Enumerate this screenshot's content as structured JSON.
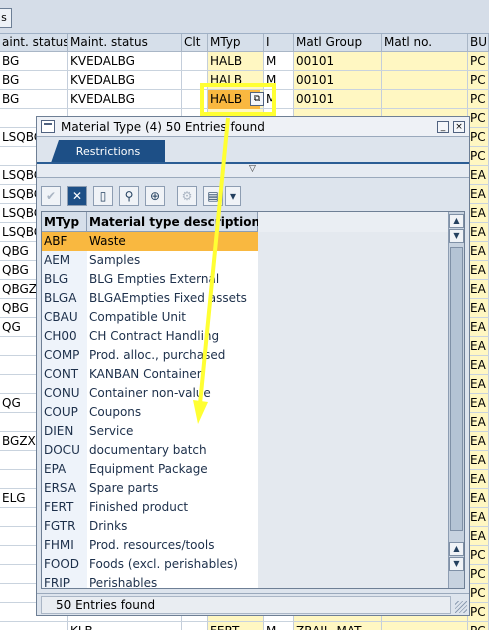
{
  "background": {
    "toolbar_button": "s",
    "headers": [
      "aint. status",
      "Maint. status",
      "Clt",
      "MTyp",
      "I",
      "Matl Group",
      "Matl no.",
      "BU"
    ],
    "rows": [
      {
        "c0": "BG",
        "c1": "KVEDALBG",
        "mtyp": "HALB",
        "i": "M",
        "grp": "00101",
        "bu": "PC"
      },
      {
        "c0": "BG",
        "c1": "KVEDALBG",
        "mtyp": "HALB",
        "i": "M",
        "grp": "00101",
        "bu": "PC"
      },
      {
        "c0": "BG",
        "c1": "KVEDALBG",
        "mtyp": "HALB",
        "i": "M",
        "grp": "00101",
        "bu": "PC"
      },
      {
        "c0": "",
        "c1": "",
        "mtyp": "",
        "i": "",
        "grp": "",
        "bu": "PC"
      },
      {
        "c0": "LSQBG",
        "c1": "",
        "mtyp": "",
        "i": "",
        "grp": "",
        "bu": "PC"
      },
      {
        "c0": "",
        "c1": "",
        "mtyp": "",
        "i": "",
        "grp": "",
        "bu": "PC"
      },
      {
        "c0": "LSQBG",
        "c1": "",
        "mtyp": "",
        "i": "",
        "grp": "",
        "bu": "EA"
      },
      {
        "c0": "LSQBG",
        "c1": "",
        "mtyp": "",
        "i": "",
        "grp": "",
        "bu": "EA"
      },
      {
        "c0": "LSQBG",
        "c1": "",
        "mtyp": "",
        "i": "",
        "grp": "",
        "bu": "EA"
      },
      {
        "c0": "LSQBG",
        "c1": "",
        "mtyp": "",
        "i": "",
        "grp": "",
        "bu": "EA"
      },
      {
        "c0": "QBG",
        "c1": "",
        "mtyp": "",
        "i": "",
        "grp": "",
        "bu": "EA"
      },
      {
        "c0": "QBG",
        "c1": "",
        "mtyp": "",
        "i": "",
        "grp": "",
        "bu": "EA"
      },
      {
        "c0": "QBGZX",
        "c1": "",
        "mtyp": "",
        "i": "",
        "grp": "",
        "bu": "EA"
      },
      {
        "c0": "QBG",
        "c1": "",
        "mtyp": "",
        "i": "",
        "grp": "",
        "bu": "EA"
      },
      {
        "c0": "QG",
        "c1": "",
        "mtyp": "",
        "i": "",
        "grp": "",
        "bu": "EA"
      },
      {
        "c0": "",
        "c1": "",
        "mtyp": "",
        "i": "",
        "grp": "",
        "bu": "EA"
      },
      {
        "c0": "",
        "c1": "",
        "mtyp": "",
        "i": "",
        "grp": "",
        "bu": "EA"
      },
      {
        "c0": "",
        "c1": "",
        "mtyp": "",
        "i": "",
        "grp": "",
        "bu": "EA"
      },
      {
        "c0": "QG",
        "c1": "",
        "mtyp": "",
        "i": "",
        "grp": "",
        "bu": "EA"
      },
      {
        "c0": "",
        "c1": "",
        "mtyp": "",
        "i": "",
        "grp": "",
        "bu": "EA"
      },
      {
        "c0": "BGZX",
        "c1": "",
        "mtyp": "",
        "i": "",
        "grp": "",
        "bu": "EA"
      },
      {
        "c0": "",
        "c1": "",
        "mtyp": "",
        "i": "",
        "grp": "",
        "bu": "EA"
      },
      {
        "c0": "",
        "c1": "",
        "mtyp": "",
        "i": "",
        "grp": "",
        "bu": "EA"
      },
      {
        "c0": "ELG",
        "c1": "",
        "mtyp": "",
        "i": "",
        "grp": "",
        "bu": "EA"
      },
      {
        "c0": "",
        "c1": "",
        "mtyp": "",
        "i": "",
        "grp": "",
        "bu": "EA"
      },
      {
        "c0": "",
        "c1": "",
        "mtyp": "",
        "i": "",
        "grp": "",
        "bu": "EA"
      },
      {
        "c0": "",
        "c1": "",
        "mtyp": "",
        "i": "",
        "grp": "",
        "bu": "PC"
      },
      {
        "c0": "",
        "c1": "",
        "mtyp": "",
        "i": "",
        "grp": "",
        "bu": "PC"
      },
      {
        "c0": "",
        "c1": "",
        "mtyp": "",
        "i": "",
        "grp": "",
        "bu": "PC"
      },
      {
        "c0": "",
        "c1": "",
        "mtyp": "",
        "i": "",
        "grp": "",
        "bu": "PC"
      },
      {
        "c0": "",
        "c1": "KLB",
        "mtyp": "FERT",
        "i": "M",
        "grp": "ZRAIL_MAT",
        "bu": "PC"
      },
      {
        "c0": "",
        "c1": "KLB",
        "mtyp": "FERT",
        "i": "M",
        "grp": "ZRAIL_MAT",
        "bu": "PC"
      }
    ]
  },
  "dialog": {
    "title": "Material Type (4)   50 Entries found",
    "tab_restrictions": "Restrictions",
    "expander_icon": "▽",
    "toolbar": [
      "check-icon",
      "cancel-icon",
      "new-page-icon",
      "find-icon",
      "find-next-icon",
      "settings-icon",
      "print-icon",
      "export-icon"
    ],
    "columns": {
      "code": "MTyp",
      "desc": "Material type description"
    },
    "items": [
      {
        "code": "ABF",
        "desc": "Waste"
      },
      {
        "code": "AEM",
        "desc": "Samples"
      },
      {
        "code": "BLG",
        "desc": "BLG Empties  External"
      },
      {
        "code": "BLGA",
        "desc": "BLGAEmpties  Fixed assets"
      },
      {
        "code": "CBAU",
        "desc": "Compatible Unit"
      },
      {
        "code": "CH00",
        "desc": "CH Contract Handling"
      },
      {
        "code": "COMP",
        "desc": "Prod. alloc., purchased"
      },
      {
        "code": "CONT",
        "desc": "KANBAN Container"
      },
      {
        "code": "CONU",
        "desc": "Container non-value"
      },
      {
        "code": "COUP",
        "desc": "Coupons"
      },
      {
        "code": "DIEN",
        "desc": "Service"
      },
      {
        "code": "DOCU",
        "desc": "documentary batch"
      },
      {
        "code": "EPA",
        "desc": "Equipment Package"
      },
      {
        "code": "ERSA",
        "desc": "Spare parts"
      },
      {
        "code": "FERT",
        "desc": "Finished product"
      },
      {
        "code": "FGTR",
        "desc": "Drinks"
      },
      {
        "code": "FHMI",
        "desc": "Prod. resources/tools"
      },
      {
        "code": "FOOD",
        "desc": "Foods (excl. perishables)"
      },
      {
        "code": "FRIP",
        "desc": "Perishables"
      }
    ],
    "selected_index": 0,
    "status": "50 Entries found"
  },
  "colors": {
    "highlight": "#ffff33",
    "selection": "#f9b840",
    "tab": "#1d4f86"
  }
}
